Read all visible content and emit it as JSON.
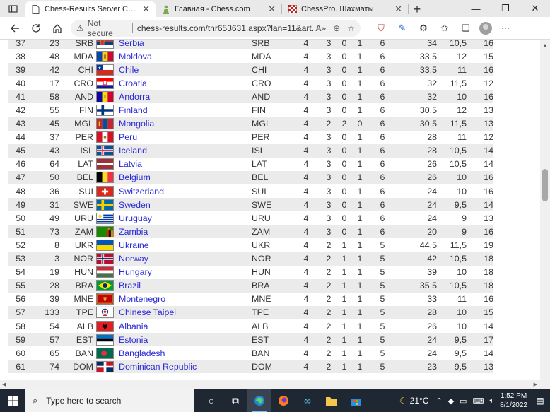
{
  "browser": {
    "tabs": [
      {
        "title": "Chess-Results Server Chess-resul",
        "active": true
      },
      {
        "title": "Главная - Chess.com",
        "active": false
      },
      {
        "title": "ChessPro. Шахматы",
        "active": false
      }
    ],
    "new_tab_label": "+",
    "security_label": "Not secure",
    "url": "chess-results.com/tnr653631.aspx?lan=11&art..."
  },
  "standings": {
    "rows": [
      {
        "rk": "37",
        "sno": "23",
        "code": "SRB",
        "flag": "serbia",
        "team": "Serbia",
        "fed": "SRB",
        "n": "4",
        "w": "3",
        "d": "0",
        "l": "1",
        "pts": "6",
        "tb1": "34",
        "tb2": "10,5",
        "tb3": "16"
      },
      {
        "rk": "38",
        "sno": "48",
        "code": "MDA",
        "flag": "moldova",
        "team": "Moldova",
        "fed": "MDA",
        "n": "4",
        "w": "3",
        "d": "0",
        "l": "1",
        "pts": "6",
        "tb1": "33,5",
        "tb2": "12",
        "tb3": "15"
      },
      {
        "rk": "39",
        "sno": "42",
        "code": "CHI",
        "flag": "chile",
        "team": "Chile",
        "fed": "CHI",
        "n": "4",
        "w": "3",
        "d": "0",
        "l": "1",
        "pts": "6",
        "tb1": "33,5",
        "tb2": "11",
        "tb3": "16"
      },
      {
        "rk": "40",
        "sno": "17",
        "code": "CRO",
        "flag": "croatia",
        "team": "Croatia",
        "fed": "CRO",
        "n": "4",
        "w": "3",
        "d": "0",
        "l": "1",
        "pts": "6",
        "tb1": "32",
        "tb2": "11,5",
        "tb3": "12"
      },
      {
        "rk": "41",
        "sno": "58",
        "code": "AND",
        "flag": "andorra",
        "team": "Andorra",
        "fed": "AND",
        "n": "4",
        "w": "3",
        "d": "0",
        "l": "1",
        "pts": "6",
        "tb1": "32",
        "tb2": "10",
        "tb3": "16"
      },
      {
        "rk": "42",
        "sno": "55",
        "code": "FIN",
        "flag": "finland",
        "team": "Finland",
        "fed": "FIN",
        "n": "4",
        "w": "3",
        "d": "0",
        "l": "1",
        "pts": "6",
        "tb1": "30,5",
        "tb2": "12",
        "tb3": "13"
      },
      {
        "rk": "43",
        "sno": "45",
        "code": "MGL",
        "flag": "mongolia",
        "team": "Mongolia",
        "fed": "MGL",
        "n": "4",
        "w": "2",
        "d": "2",
        "l": "0",
        "pts": "6",
        "tb1": "30,5",
        "tb2": "11,5",
        "tb3": "13"
      },
      {
        "rk": "44",
        "sno": "37",
        "code": "PER",
        "flag": "peru",
        "team": "Peru",
        "fed": "PER",
        "n": "4",
        "w": "3",
        "d": "0",
        "l": "1",
        "pts": "6",
        "tb1": "28",
        "tb2": "11",
        "tb3": "12"
      },
      {
        "rk": "45",
        "sno": "43",
        "code": "ISL",
        "flag": "iceland",
        "team": "Iceland",
        "fed": "ISL",
        "n": "4",
        "w": "3",
        "d": "0",
        "l": "1",
        "pts": "6",
        "tb1": "28",
        "tb2": "10,5",
        "tb3": "14"
      },
      {
        "rk": "46",
        "sno": "64",
        "code": "LAT",
        "flag": "latvia",
        "team": "Latvia",
        "fed": "LAT",
        "n": "4",
        "w": "3",
        "d": "0",
        "l": "1",
        "pts": "6",
        "tb1": "26",
        "tb2": "10,5",
        "tb3": "14"
      },
      {
        "rk": "47",
        "sno": "50",
        "code": "BEL",
        "flag": "belgium",
        "team": "Belgium",
        "fed": "BEL",
        "n": "4",
        "w": "3",
        "d": "0",
        "l": "1",
        "pts": "6",
        "tb1": "26",
        "tb2": "10",
        "tb3": "16"
      },
      {
        "rk": "48",
        "sno": "36",
        "code": "SUI",
        "flag": "switzerland",
        "team": "Switzerland",
        "fed": "SUI",
        "n": "4",
        "w": "3",
        "d": "0",
        "l": "1",
        "pts": "6",
        "tb1": "24",
        "tb2": "10",
        "tb3": "16"
      },
      {
        "rk": "49",
        "sno": "31",
        "code": "SWE",
        "flag": "sweden",
        "team": "Sweden",
        "fed": "SWE",
        "n": "4",
        "w": "3",
        "d": "0",
        "l": "1",
        "pts": "6",
        "tb1": "24",
        "tb2": "9,5",
        "tb3": "14"
      },
      {
        "rk": "50",
        "sno": "49",
        "code": "URU",
        "flag": "uruguay",
        "team": "Uruguay",
        "fed": "URU",
        "n": "4",
        "w": "3",
        "d": "0",
        "l": "1",
        "pts": "6",
        "tb1": "24",
        "tb2": "9",
        "tb3": "13"
      },
      {
        "rk": "51",
        "sno": "73",
        "code": "ZAM",
        "flag": "zambia",
        "team": "Zambia",
        "fed": "ZAM",
        "n": "4",
        "w": "3",
        "d": "0",
        "l": "1",
        "pts": "6",
        "tb1": "20",
        "tb2": "9",
        "tb3": "16"
      },
      {
        "rk": "52",
        "sno": "8",
        "code": "UKR",
        "flag": "ukraine",
        "team": "Ukraine",
        "fed": "UKR",
        "n": "4",
        "w": "2",
        "d": "1",
        "l": "1",
        "pts": "5",
        "tb1": "44,5",
        "tb2": "11,5",
        "tb3": "19"
      },
      {
        "rk": "53",
        "sno": "3",
        "code": "NOR",
        "flag": "norway",
        "team": "Norway",
        "fed": "NOR",
        "n": "4",
        "w": "2",
        "d": "1",
        "l": "1",
        "pts": "5",
        "tb1": "42",
        "tb2": "10,5",
        "tb3": "18"
      },
      {
        "rk": "54",
        "sno": "19",
        "code": "HUN",
        "flag": "hungary",
        "team": "Hungary",
        "fed": "HUN",
        "n": "4",
        "w": "2",
        "d": "1",
        "l": "1",
        "pts": "5",
        "tb1": "39",
        "tb2": "10",
        "tb3": "18"
      },
      {
        "rk": "55",
        "sno": "28",
        "code": "BRA",
        "flag": "brazil",
        "team": "Brazil",
        "fed": "BRA",
        "n": "4",
        "w": "2",
        "d": "1",
        "l": "1",
        "pts": "5",
        "tb1": "35,5",
        "tb2": "10,5",
        "tb3": "18"
      },
      {
        "rk": "56",
        "sno": "39",
        "code": "MNE",
        "flag": "montenegro",
        "team": "Montenegro",
        "fed": "MNE",
        "n": "4",
        "w": "2",
        "d": "1",
        "l": "1",
        "pts": "5",
        "tb1": "33",
        "tb2": "11",
        "tb3": "16"
      },
      {
        "rk": "57",
        "sno": "133",
        "code": "TPE",
        "flag": "chinese-taipei",
        "team": "Chinese Taipei",
        "fed": "TPE",
        "n": "4",
        "w": "2",
        "d": "1",
        "l": "1",
        "pts": "5",
        "tb1": "28",
        "tb2": "10",
        "tb3": "15"
      },
      {
        "rk": "58",
        "sno": "54",
        "code": "ALB",
        "flag": "albania",
        "team": "Albania",
        "fed": "ALB",
        "n": "4",
        "w": "2",
        "d": "1",
        "l": "1",
        "pts": "5",
        "tb1": "26",
        "tb2": "10",
        "tb3": "14"
      },
      {
        "rk": "59",
        "sno": "57",
        "code": "EST",
        "flag": "estonia",
        "team": "Estonia",
        "fed": "EST",
        "n": "4",
        "w": "2",
        "d": "1",
        "l": "1",
        "pts": "5",
        "tb1": "24",
        "tb2": "9,5",
        "tb3": "17"
      },
      {
        "rk": "60",
        "sno": "65",
        "code": "BAN",
        "flag": "bangladesh",
        "team": "Bangladesh",
        "fed": "BAN",
        "n": "4",
        "w": "2",
        "d": "1",
        "l": "1",
        "pts": "5",
        "tb1": "24",
        "tb2": "9,5",
        "tb3": "14"
      },
      {
        "rk": "61",
        "sno": "74",
        "code": "DOM",
        "flag": "dominican-republic",
        "team": "Dominican Republic",
        "fed": "DOM",
        "n": "4",
        "w": "2",
        "d": "1",
        "l": "1",
        "pts": "5",
        "tb1": "23",
        "tb2": "9,5",
        "tb3": "13"
      }
    ]
  },
  "taskbar": {
    "search_placeholder": "Type here to search",
    "temperature": "21°C",
    "time": "1:52 PM",
    "date": "8/1/2022"
  },
  "colors": {
    "link": "#2b2bd6",
    "row_alt": "#ebebeb",
    "taskbar": "#1f2732"
  }
}
